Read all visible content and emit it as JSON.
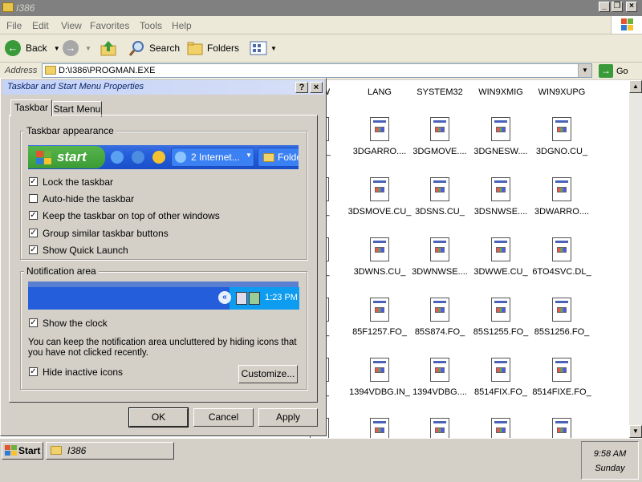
{
  "window": {
    "title": "I386"
  },
  "menu": [
    "File",
    "Edit",
    "View",
    "Favorites",
    "Tools",
    "Help"
  ],
  "toolbar": {
    "back": "Back",
    "search": "Search",
    "folders": "Folders"
  },
  "address": {
    "label": "Address",
    "value": "D:\\I386\\PROGMAN.EXE",
    "go": "Go"
  },
  "files": {
    "col_headers": [
      "W",
      "LANG",
      "SYSTEM32",
      "WIN9XMIG",
      "WIN9XUPG"
    ],
    "rows": [
      [
        "K.IN_",
        "3DGARRO....",
        "3DGMOVE....",
        "3DGNESW....",
        "3DGNO.CU_"
      ],
      [
        ".CU_",
        "3DSMOVE.CU_",
        "3DSNS.CU_",
        "3DSNWSE....",
        "3DWARRO...."
      ],
      [
        ".CU_",
        "3DWNS.CU_",
        "3DWNWSE....",
        "3DWWE.CU_",
        "6TO4SVC.DL_"
      ],
      [
        ".FO_",
        "85F1257.FO_",
        "85S874.FO_",
        "85S1255.FO_",
        "85S1256.FO_"
      ],
      [
        ".SY_",
        "1394VDBG.IN_",
        "1394VDBG....",
        "8514FIX.FO_",
        "8514FIXE.FO_"
      ]
    ]
  },
  "dialog": {
    "title": "Taskbar and Start Menu Properties",
    "help": "?",
    "tabs": [
      "Taskbar",
      "Start Menu"
    ],
    "appearance": {
      "title": "Taskbar appearance",
      "preview_start": "start",
      "preview_task1": "2 Internet...",
      "preview_task2": "Folde",
      "options": [
        {
          "label": "Lock the taskbar",
          "checked": true
        },
        {
          "label": "Auto-hide the taskbar",
          "checked": false
        },
        {
          "label": "Keep the taskbar on top of other windows",
          "checked": true
        },
        {
          "label": "Group similar taskbar buttons",
          "checked": true
        },
        {
          "label": "Show Quick Launch",
          "checked": true
        }
      ]
    },
    "notification": {
      "title": "Notification area",
      "preview_time": "1:23 PM",
      "show_clock": "Show the clock",
      "description": "You can keep the notification area uncluttered by hiding icons that you have not clicked recently.",
      "hide_inactive": "Hide inactive icons",
      "customize": "Customize..."
    },
    "buttons": {
      "ok": "OK",
      "cancel": "Cancel",
      "apply": "Apply"
    }
  },
  "taskbar": {
    "start": "Start",
    "task": "I386",
    "time": "9:58 AM",
    "day": "Sunday"
  }
}
